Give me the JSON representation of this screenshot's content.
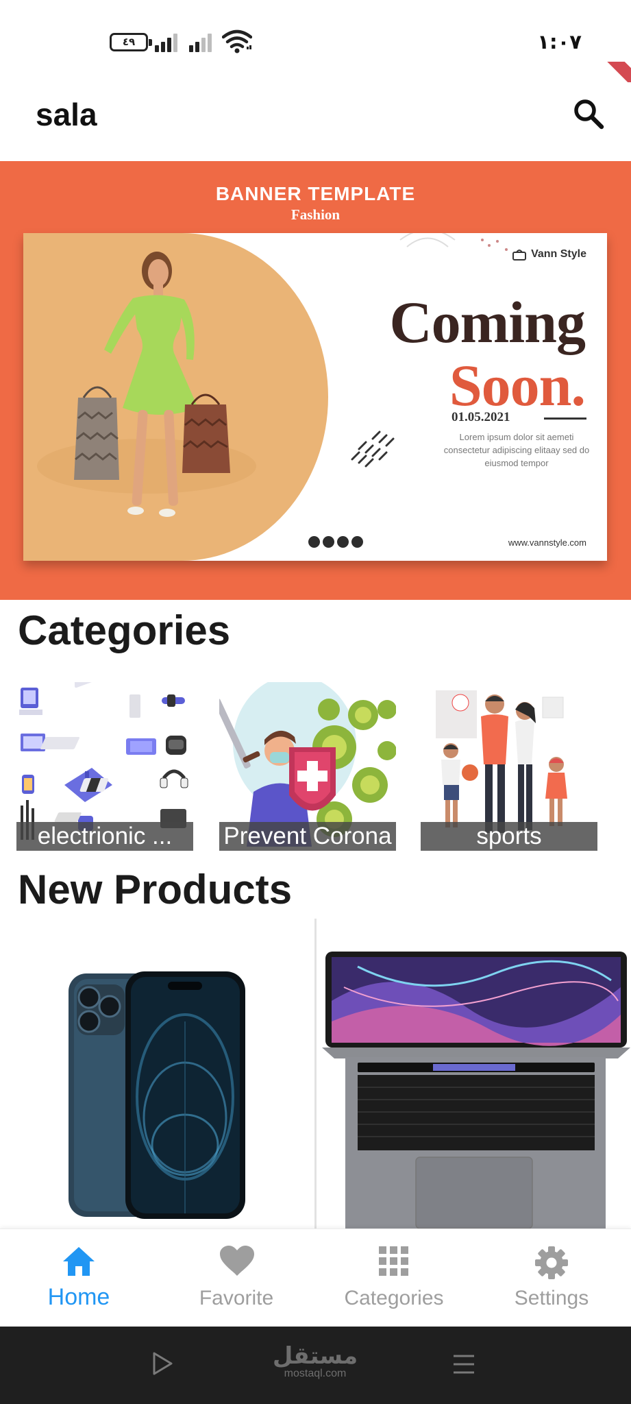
{
  "status_bar": {
    "battery": "٤٩",
    "time": "١:٠٧"
  },
  "app_bar": {
    "title": "sala",
    "search_icon": "search-icon"
  },
  "banner": {
    "heading": "BANNER TEMPLATE",
    "subheading": "Fashion",
    "brand": "Vann Style",
    "coming": "Coming",
    "soon": "Soon.",
    "date": "01.05.2021",
    "lorem": "Lorem ipsum dolor sit aemeti consectetur adipiscing elitaay sed do eiusmod tempor",
    "website": "www.vannstyle.com",
    "colors": {
      "background": "#ef6a45",
      "dark_text": "#3a2521",
      "accent_text": "#e05a3d"
    }
  },
  "categories": {
    "title": "Categories",
    "items": [
      {
        "label": "electrionic ..."
      },
      {
        "label": "Prevent Corona"
      },
      {
        "label": "sports"
      }
    ]
  },
  "new_products": {
    "title": "New Products",
    "items": [
      {
        "image": "blue-smartphone"
      },
      {
        "image": "laptop"
      }
    ]
  },
  "bottom_nav": {
    "items": [
      {
        "label": "Home",
        "icon": "home-icon",
        "active": true
      },
      {
        "label": "Favorite",
        "icon": "heart-icon",
        "active": false
      },
      {
        "label": "Categories",
        "icon": "grid-icon",
        "active": false
      },
      {
        "label": "Settings",
        "icon": "gear-icon",
        "active": false
      }
    ],
    "active_color": "#2196f3",
    "inactive_color": "#9e9e9e"
  },
  "system_nav": {
    "watermark_arabic": "مستقل",
    "watermark_latin": "mostaql.com"
  }
}
